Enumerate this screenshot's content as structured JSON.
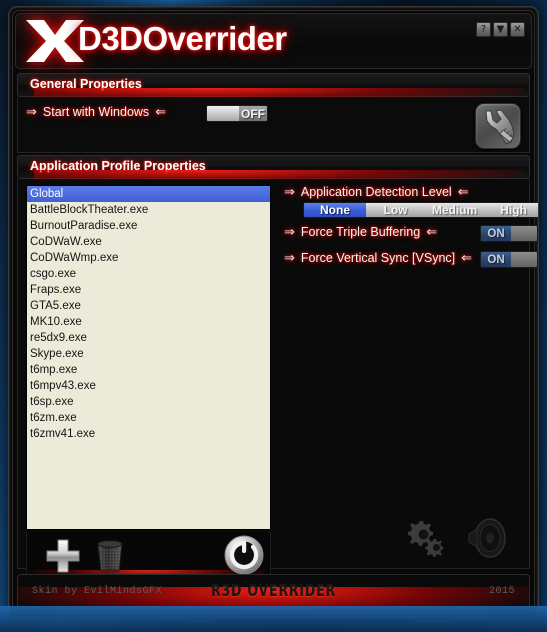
{
  "window": {
    "app_title": "D3DOverrider",
    "logo_icon": "x-logo-icon",
    "controls": [
      {
        "name": "help-button",
        "glyph": "?"
      },
      {
        "name": "minimize-button",
        "glyph": "▼"
      },
      {
        "name": "close-button",
        "glyph": "✕"
      }
    ]
  },
  "general": {
    "header": "General Properties",
    "start_with_windows": {
      "label": "Start with Windows",
      "value": "OFF",
      "arrow_left": "⇒",
      "arrow_right": "⇐"
    },
    "tool_icon": "wrench-icon"
  },
  "profiles": {
    "header": "Application Profile Properties",
    "items": [
      "Global",
      "BattleBlockTheater.exe",
      "BurnoutParadise.exe",
      "CoDWaW.exe",
      "CoDWaWmp.exe",
      "csgo.exe",
      "Fraps.exe",
      "GTA5.exe",
      "MK10.exe",
      "re5dx9.exe",
      "Skype.exe",
      "t6mp.exe",
      "t6mpv43.exe",
      "t6sp.exe",
      "t6zm.exe",
      "t6zmv41.exe"
    ],
    "selected": "Global",
    "toolbar": [
      {
        "name": "add-profile-button",
        "icon": "plus-icon"
      },
      {
        "name": "delete-profile-button",
        "icon": "trash-icon"
      },
      {
        "name": "restart-button",
        "icon": "power-refresh-icon"
      }
    ]
  },
  "options": {
    "detection": {
      "label": "Application Detection Level",
      "arrow_left": "⇒",
      "arrow_right": "⇐",
      "levels": [
        "None",
        "Low",
        "Medium",
        "High"
      ],
      "selected": "None"
    },
    "triple_buffering": {
      "label": "Force Triple Buffering",
      "arrow_left": "⇒",
      "arrow_right": "⇐",
      "value": "ON"
    },
    "vsync": {
      "label": "Force Vertical Sync [VSync]",
      "arrow_left": "⇒",
      "arrow_right": "⇐",
      "value": "ON"
    },
    "extra_icons": [
      {
        "name": "gears-icon",
        "icon": "gears-icon"
      },
      {
        "name": "speaker-icon",
        "icon": "speaker-icon"
      }
    ]
  },
  "footer": {
    "skin_credit": "Skin by EvilMindsGFX",
    "brand": "R3D OVERRIDER",
    "year": "2015"
  },
  "colors": {
    "accent_red": "#ff1a10",
    "selection_blue": "#3f5fd4",
    "list_background": "#ecead9",
    "window_background": "#0a0a0a"
  }
}
